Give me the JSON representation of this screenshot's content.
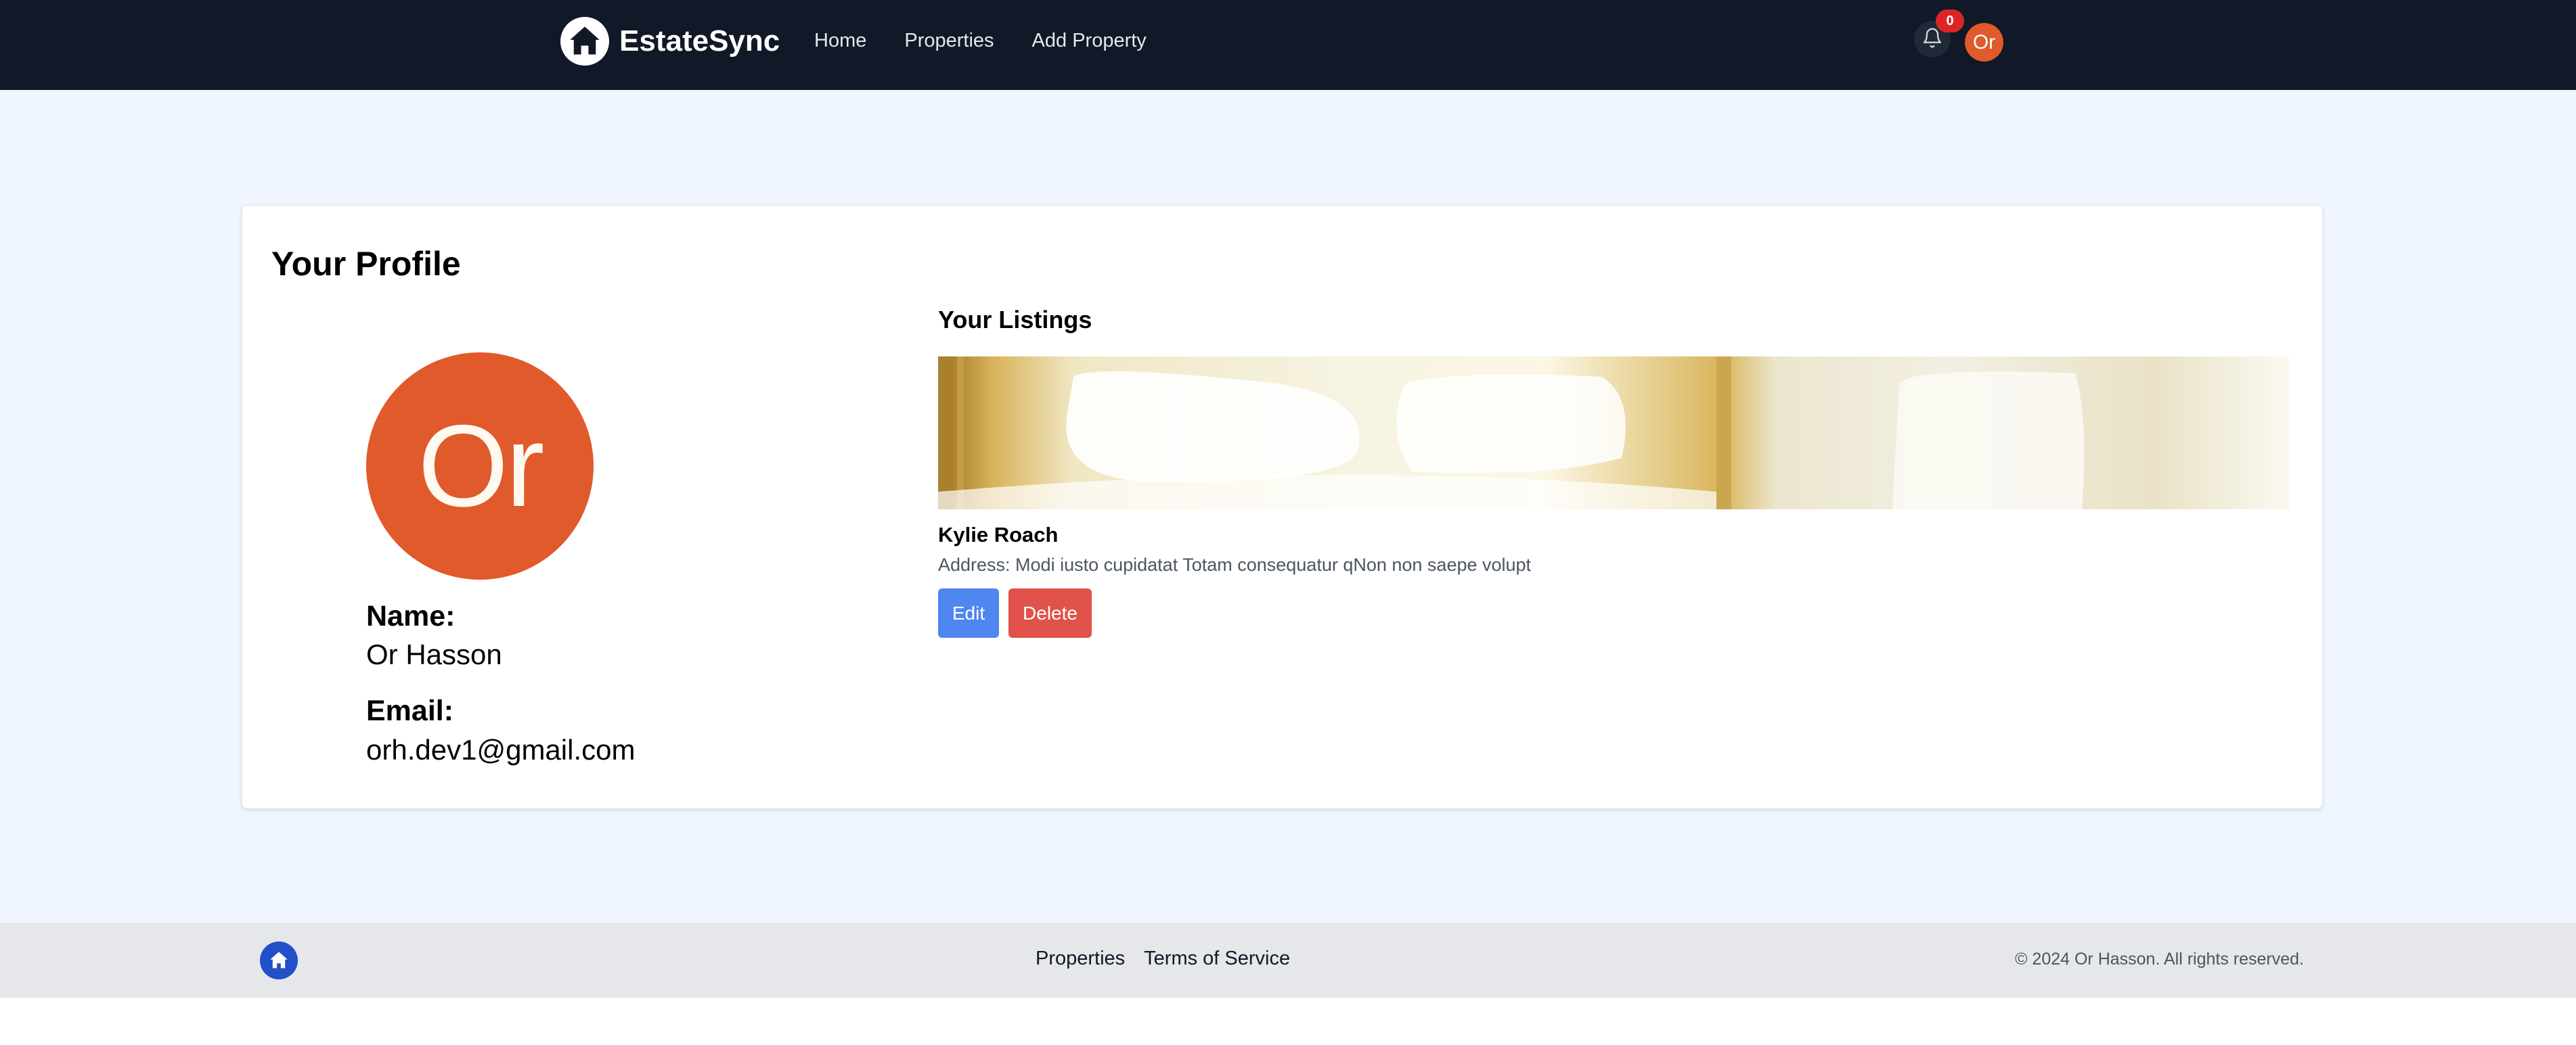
{
  "header": {
    "brand": "EstateSync",
    "nav": [
      "Home",
      "Properties",
      "Add Property"
    ],
    "notification_count": "0",
    "avatar_initials": "Or"
  },
  "profile": {
    "title": "Your Profile",
    "avatar_initials": "Or",
    "name_label": "Name:",
    "name_value": "Or Hasson",
    "email_label": "Email:",
    "email_value": "orh.dev1@gmail.com"
  },
  "listings": {
    "title": "Your Listings",
    "items": [
      {
        "name": "Kylie Roach",
        "address": "Address: Modi iusto cupidatat Totam consequatur qNon non saepe volupt",
        "edit_label": "Edit",
        "delete_label": "Delete"
      }
    ]
  },
  "footer": {
    "links": [
      "Properties",
      "Terms of Service"
    ],
    "copyright": "© 2024 Or Hasson. All rights reserved."
  },
  "colors": {
    "navbar": "#111827",
    "page_bg": "#eff6ff",
    "avatar": "#e05a2b",
    "edit_button": "#4f86f0",
    "delete_button": "#e0524a",
    "footer_bg": "#e5e7eb",
    "footer_logo": "#2150c9"
  },
  "icons": {
    "brand": "home-icon",
    "notifications": "bell-icon",
    "footer": "home-icon"
  }
}
